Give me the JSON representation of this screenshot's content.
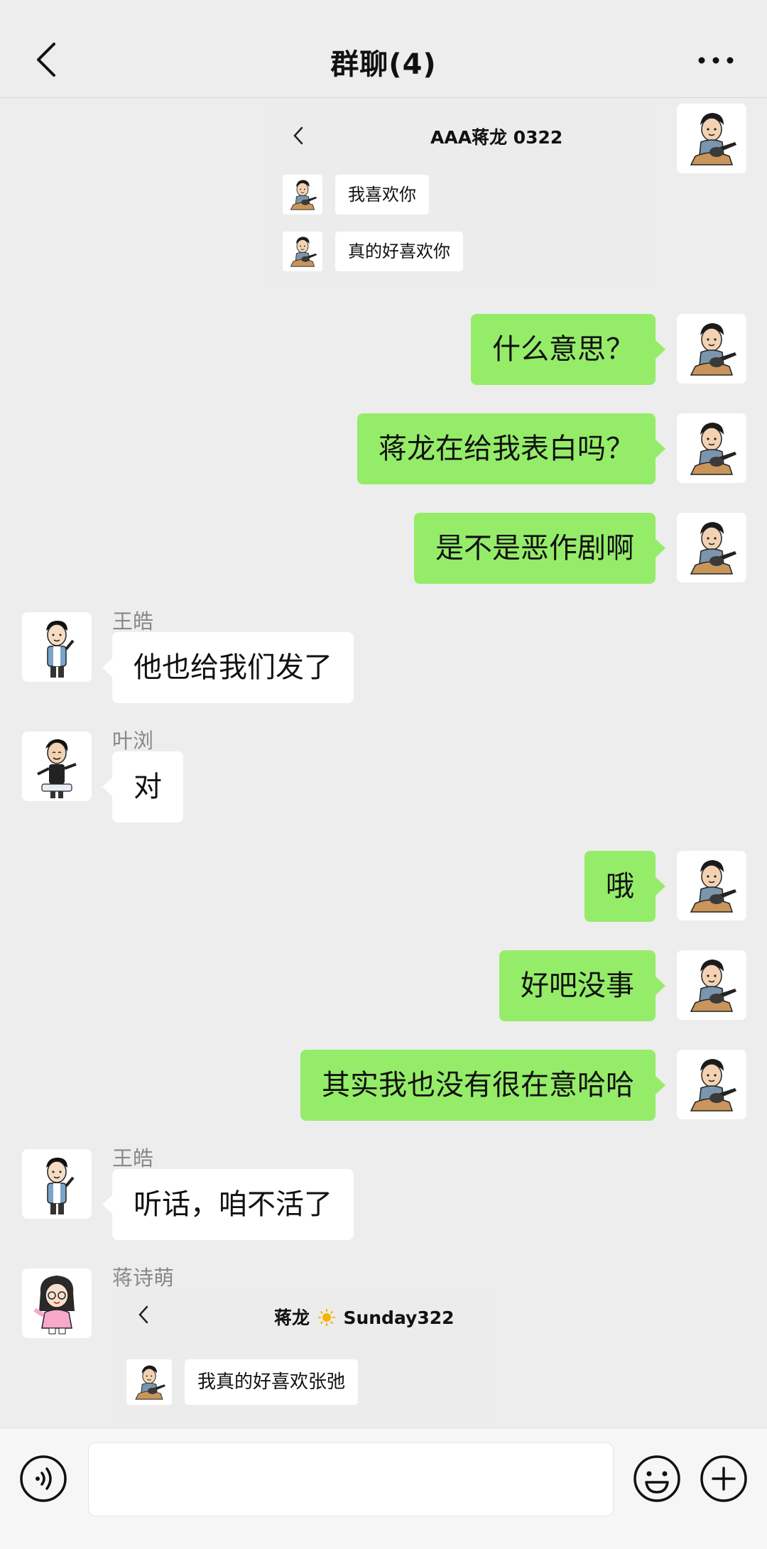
{
  "header": {
    "title": "群聊(4)",
    "back_icon": "chevron-left-icon",
    "more_icon": "more-dots-icon"
  },
  "colors": {
    "background": "#ededed",
    "sent_bubble": "#95ec69",
    "received_bubble": "#ffffff",
    "sender_name": "#888888"
  },
  "messages": [
    {
      "side": "right",
      "type": "image",
      "image": {
        "title": "AAA蒋龙 0322",
        "rows": [
          "我喜欢你",
          "真的好喜欢你"
        ]
      }
    },
    {
      "side": "right",
      "type": "text",
      "text": "什么意思？"
    },
    {
      "side": "right",
      "type": "text",
      "text": "蒋龙在给我表白吗？"
    },
    {
      "side": "right",
      "type": "text",
      "text": "是不是恶作剧啊"
    },
    {
      "side": "left",
      "type": "text",
      "sender": "王皓",
      "text": "他也给我们发了"
    },
    {
      "side": "left",
      "type": "text",
      "sender": "叶浏",
      "text": "对"
    },
    {
      "side": "right",
      "type": "text",
      "text": "哦"
    },
    {
      "side": "right",
      "type": "text",
      "text": "好吧没事"
    },
    {
      "side": "right",
      "type": "text",
      "text": "其实我也没有很在意哈哈"
    },
    {
      "side": "left",
      "type": "text",
      "sender": "王皓",
      "text": "听话，咱不活了"
    },
    {
      "side": "left",
      "type": "image",
      "sender": "蒋诗萌",
      "image": {
        "title_prefix": "蒋龙",
        "title_icon": "sun-icon",
        "title_suffix": "Sunday322",
        "rows": [
          "我真的好喜欢张弛"
        ]
      }
    }
  ],
  "input_bar": {
    "voice_icon": "voice-icon",
    "input_value": "",
    "emoji_icon": "emoji-icon",
    "plus_icon": "plus-icon"
  }
}
